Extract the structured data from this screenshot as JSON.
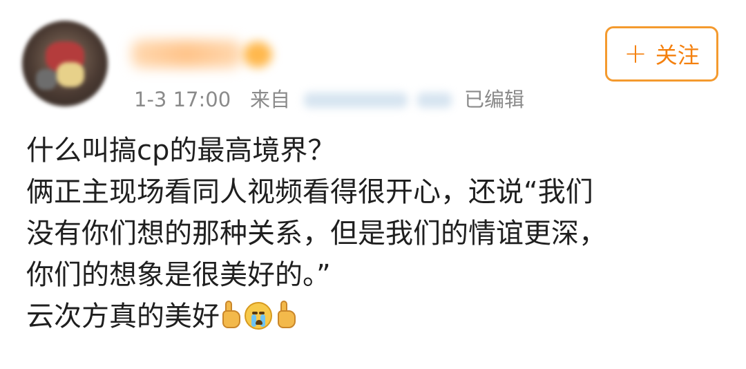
{
  "post": {
    "username": "Caro■■■",
    "meta": {
      "time": "1-3 17:00",
      "from_label": "来自",
      "edited_label": "已编辑"
    },
    "follow_button": {
      "plus": "+",
      "label": "关注"
    },
    "content_lines": [
      "什么叫搞cp的最高境界？",
      "俩正主现场看同人视频看得很开心，还说“我们",
      "没有你们想的那种关系，但是我们的情谊更深，",
      "你们的想象是很美好的。”",
      "云次方真的美好"
    ],
    "emojis": [
      "thumbs-up-icon",
      "crying-face-icon",
      "thumbs-up-icon"
    ]
  },
  "colors": {
    "accent": "#f49a2e",
    "meta_text": "#8a8a8a",
    "body_text": "#1f1f1f"
  }
}
